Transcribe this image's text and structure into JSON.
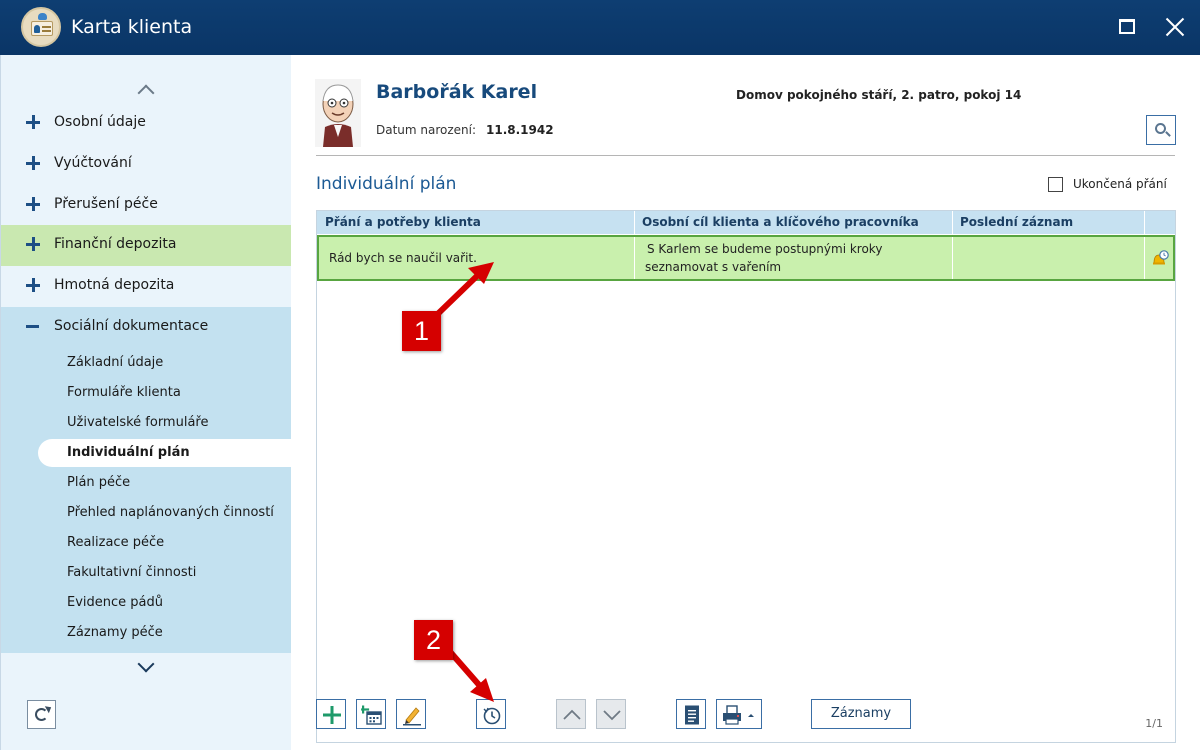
{
  "window": {
    "title": "Karta klienta"
  },
  "sidebar": {
    "items": [
      {
        "label": "Osobní údaje",
        "state": "collapsed"
      },
      {
        "label": "Vyúčtování",
        "state": "collapsed"
      },
      {
        "label": "Přerušení péče",
        "state": "collapsed"
      },
      {
        "label": "Finanční depozita",
        "state": "collapsed"
      },
      {
        "label": "Hmotná depozita",
        "state": "collapsed"
      },
      {
        "label": "Sociální dokumentace",
        "state": "expanded"
      }
    ],
    "sub_items": [
      {
        "label": "Základní údaje"
      },
      {
        "label": "Formuláře klienta"
      },
      {
        "label": "Uživatelské formuláře"
      },
      {
        "label": "Individuální plán",
        "active": true
      },
      {
        "label": "Plán péče"
      },
      {
        "label": "Přehled naplánovaných činností"
      },
      {
        "label": "Realizace péče"
      },
      {
        "label": "Fakultativní činnosti"
      },
      {
        "label": "Evidence pádů"
      },
      {
        "label": "Záznamy péče"
      }
    ]
  },
  "client": {
    "name": "Barbořák Karel",
    "birth_label": "Datum narození:",
    "birth_date": "11.8.1942",
    "location": "Domov pokojného stáří, 2. patro, pokoj 14"
  },
  "plan": {
    "title": "Individuální plán",
    "ended_wishes_label": "Ukončená přání",
    "ended_wishes_checked": false,
    "columns": [
      "Přání a potřeby klienta",
      "Osobní cíl klienta a klíčového pracovníka",
      "Poslední záznam"
    ],
    "rows": [
      {
        "wish": "Rád bych se naučil vařit.",
        "goal_line1": "S Karlem se budeme postupnými kroky",
        "goal_line2": "seznamovat s vařením",
        "last_record": ""
      }
    ],
    "pager": "1/1"
  },
  "toolbar": {
    "records_label": "Záznamy"
  },
  "annotations": {
    "badge1": "1",
    "badge2": "2"
  },
  "colors": {
    "titlebar": "#0e3e72",
    "sidebar_bg": "#eaf4fb",
    "sidebar_active_block": "#c3e1f0",
    "finance_highlight": "#c9e8b0",
    "selected_row": "#c9f0ad",
    "selected_row_border": "#58a540",
    "accent": "#174a7c",
    "annotation": "#d50000"
  }
}
